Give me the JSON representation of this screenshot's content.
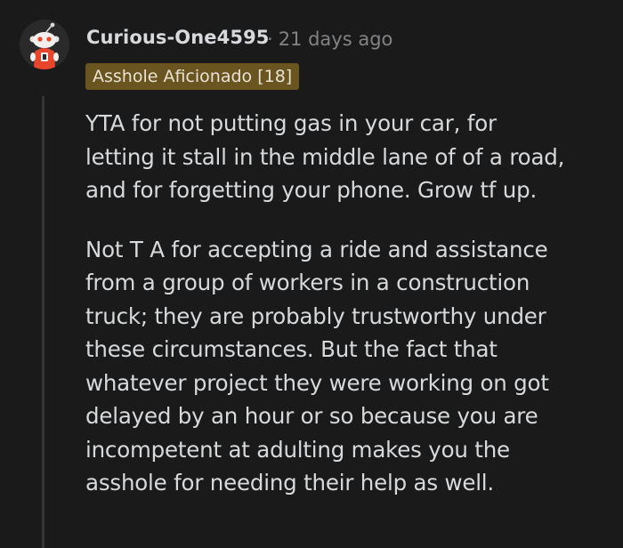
{
  "comment": {
    "author": "Curious-One4595",
    "separator": "·",
    "timestamp": "21 days ago",
    "flair": "Asshole Aficionado [18]",
    "avatar_icon": "snoo-avatar-icon",
    "paragraphs": [
      {
        "lines": [
          "YTA for not putting gas in your car, for",
          "letting it stall in the middle lane of of a road,",
          "and for forgetting your phone. Grow tf up."
        ]
      },
      {
        "lines": [
          "Not T A for accepting a ride and assistance",
          "from a group of workers in a construction",
          "truck; they are probably trustworthy under",
          "these circumstances. But the fact that",
          "whatever project they were working on got",
          "delayed by an hour or so because you are",
          "incompetent at adulting makes you the",
          "asshole for needing their help as well."
        ]
      }
    ]
  },
  "colors": {
    "background": "#1a1a1b",
    "text": "#d7dadc",
    "muted": "#818384",
    "flair_bg": "#6a5420",
    "thread_line": "#343536",
    "avatar_accent": "#e8452c"
  }
}
